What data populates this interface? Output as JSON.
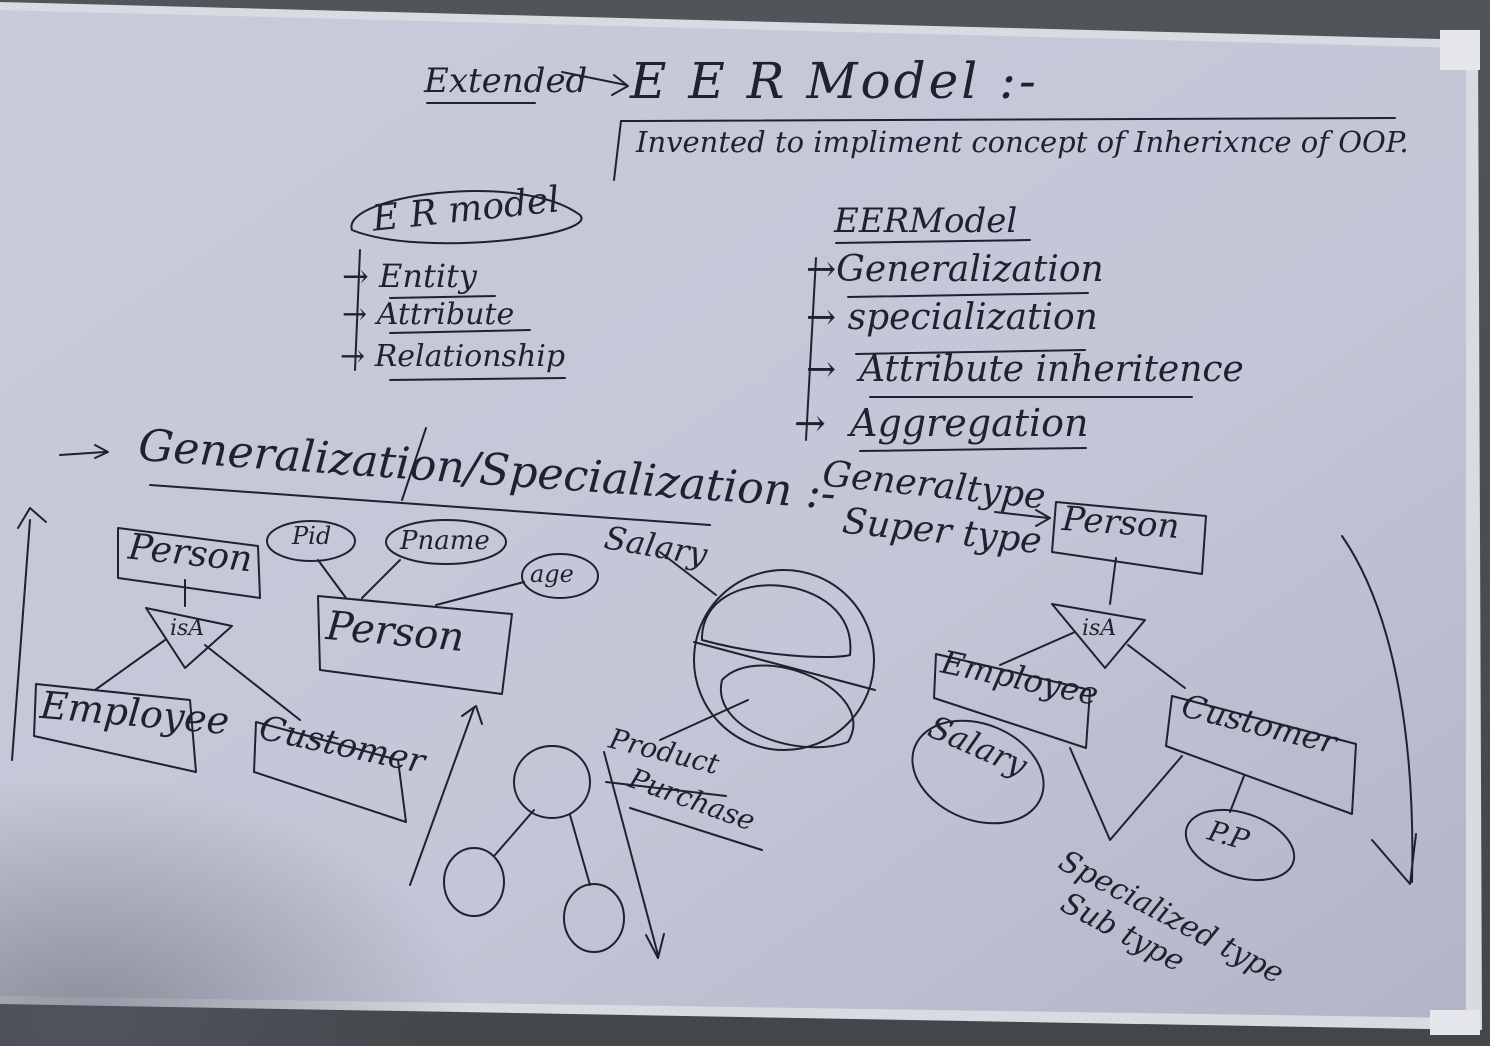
{
  "board": {
    "colors": {
      "board": "#c9ccdb",
      "ink": "#1d2230",
      "frame": "#e2e4ea"
    },
    "title": {
      "extended": "Extended",
      "main": "E E R Model :-",
      "subtitle": "Invented to impliment concept of Inherixnce of OOP."
    },
    "er_model": {
      "heading": "E R model",
      "items": [
        "Entity",
        "Attribute",
        "Relationship"
      ]
    },
    "eer_model": {
      "heading": "EERModel",
      "items": [
        "Generalization",
        "specialization",
        "Attribute inheritence",
        "Aggregation"
      ]
    },
    "section": {
      "heading": "Generalization/Specialization :-"
    },
    "left_diagram": {
      "parent": "Person",
      "isa": "isA",
      "children": [
        "Employee",
        "Customer"
      ]
    },
    "middle_diagram": {
      "entity": "Person",
      "attributes": [
        "Pid",
        "Pname",
        "age"
      ]
    },
    "sets_diagram": {
      "labels": [
        "Salary",
        "Product",
        "Purchase"
      ]
    },
    "right_diagram": {
      "generalized_label_1": "Generaltype",
      "generalized_label_2": "Super type",
      "parent": "Person",
      "isa": "isA",
      "children": [
        "Employee",
        "Customer"
      ],
      "child_attributes": [
        "Salary",
        "P.P"
      ],
      "specialized_label_1": "Specialized type",
      "specialized_label_2": "Sub type"
    }
  }
}
